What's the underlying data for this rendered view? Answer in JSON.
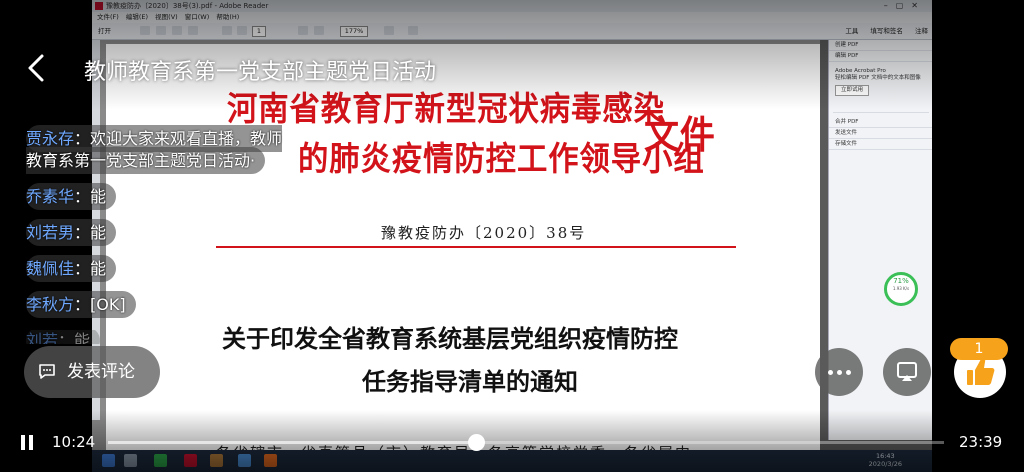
{
  "stream": {
    "title": "教师教育系第一党支部主题党日活动",
    "comments": [
      {
        "user": "贾永存",
        "text": "欢迎大家来观看直播，教师教育系第一党支部主题党日活动·"
      },
      {
        "user": "乔素华",
        "text": "能"
      },
      {
        "user": "刘若男",
        "text": "能"
      },
      {
        "user": "魏佩佳",
        "text": "能"
      },
      {
        "user": "李秋方",
        "text": "[OK]"
      },
      {
        "user": "刘若",
        "text": "能"
      }
    ],
    "comment_placeholder": "发表评论",
    "like_count": "1",
    "time_current": "10:24",
    "time_total": "23:39",
    "progress_fraction": 0.44
  },
  "desktop": {
    "window_title": "豫教疫防办〔2020〕38号(3).pdf - Adobe Reader",
    "menu": [
      "文件(F)",
      "编辑(E)",
      "视图(V)",
      "窗口(W)",
      "帮助(H)"
    ],
    "toolbar_open": "打开",
    "page_number": "1",
    "zoom": "177%",
    "right_tabs": [
      "工具",
      "填写和签名",
      "注释"
    ],
    "panel_rows": [
      "创建 PDF",
      "编辑 PDF"
    ],
    "panel_box_title": "Adobe Acrobat Pro",
    "panel_box_text": "轻松编辑 PDF 文档中的文本和图像",
    "panel_box_button": "立即试用",
    "panel_rows_lower": [
      "合并 PDF",
      "发送文件",
      "存储文件"
    ],
    "speed_percent": "71%",
    "speed_rate": "1.93 K/s",
    "clock_time": "16:43",
    "clock_date": "2020/3/26"
  },
  "document": {
    "header_line1": "河南省教育厅新型冠状病毒感染",
    "header_line2": "的肺炎疫情防控工作领导小组",
    "header_suffix": "文件",
    "doc_number": "豫教疫防办〔2020〕38号",
    "notice_title_line1": "关于印发全省教育系统基层党组织疫情防控",
    "notice_title_line2": "任务指导清单的通知",
    "addressee": "各省辖市、省直管县（市）教育局，各高等学校党委，各省属中"
  },
  "colors": {
    "document_red": "#d3131a",
    "username_blue": "#6fa8ff",
    "like_orange": "#f7a21b",
    "gauge_green": "#3bbf57"
  }
}
